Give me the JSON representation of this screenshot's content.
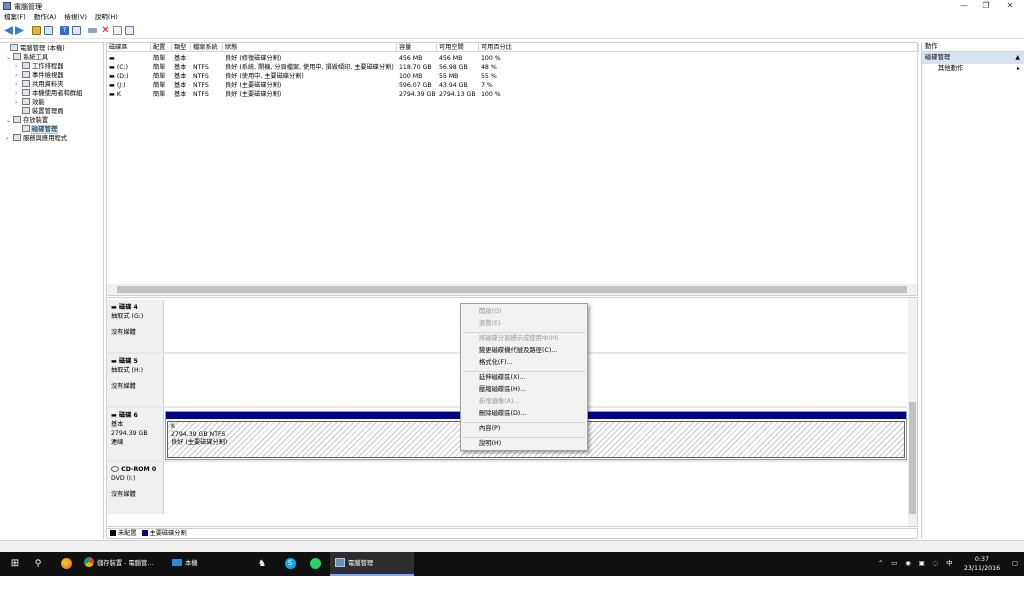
{
  "window": {
    "title": "電腦管理",
    "minimize_glyph": "—",
    "maximize_glyph": "❐",
    "close_glyph": "✕"
  },
  "menu": [
    "檔案(F)",
    "動作(A)",
    "檢視(V)",
    "說明(H)"
  ],
  "toolbar_icons": [
    "back-icon",
    "forward-icon",
    "up-folder-icon",
    "show-tree-icon",
    "help-icon",
    "show-pane-icon",
    "connect-icon",
    "delete-icon",
    "check-icon",
    "properties-icon"
  ],
  "tree": [
    {
      "label": "電腦管理 (本機)",
      "expander": ""
    },
    {
      "label": "系統工具",
      "expander": "⌄"
    },
    {
      "label": "工作排程器",
      "expander": "›"
    },
    {
      "label": "事件檢視器",
      "expander": "›"
    },
    {
      "label": "共用資料夾",
      "expander": "›"
    },
    {
      "label": "本機使用者和群組",
      "expander": "›"
    },
    {
      "label": "效能",
      "expander": "›"
    },
    {
      "label": "裝置管理員",
      "expander": ""
    },
    {
      "label": "存放裝置",
      "expander": "⌄"
    },
    {
      "label": "磁碟管理",
      "expander": ""
    },
    {
      "label": "服務與應用程式",
      "expander": "›"
    }
  ],
  "volume_table": {
    "headers": [
      "磁碟區",
      "配置",
      "類型",
      "檔案系統",
      "狀態",
      "容量",
      "可用空間",
      "可用百分比"
    ],
    "rows": [
      [
        "▬",
        "簡單",
        "基本",
        "",
        "良好 (修復磁碟分割)",
        "456 MB",
        "456 MB",
        "100 %"
      ],
      [
        "▬ (C:)",
        "簡單",
        "基本",
        "NTFS",
        "良好 (系統, 開機, 分頁檔案, 使用中, 損毀傾印, 主要磁碟分割)",
        "118.70 GB",
        "56.98 GB",
        "48 %"
      ],
      [
        "▬ (D:)",
        "簡單",
        "基本",
        "NTFS",
        "良好 (使用中, 主要磁碟分割)",
        "100 MB",
        "55 MB",
        "55 %"
      ],
      [
        "▬ (J:)",
        "簡單",
        "基本",
        "NTFS",
        "良好 (主要磁碟分割)",
        "596.07 GB",
        "43.94 GB",
        "7 %"
      ],
      [
        "▬ K",
        "簡單",
        "基本",
        "NTFS",
        "良好 (主要磁碟分割)",
        "2794.39 GB",
        "2794.13 GB",
        "100 %"
      ]
    ]
  },
  "disks": [
    {
      "name": "▬ 磁碟 4",
      "type": "抽取式 (G:)",
      "size": "",
      "status": "沒有媒體",
      "partition": null
    },
    {
      "name": "▬ 磁碟 5",
      "type": "抽取式 (H:)",
      "size": "",
      "status": "沒有媒體",
      "partition": null
    },
    {
      "name": "▬ 磁碟 6",
      "type": "基本",
      "size": "2794.39 GB",
      "status": "連線",
      "partition": {
        "label": "K",
        "size": "2794.39 GB NTFS",
        "status": "良好 (主要磁碟分割)"
      }
    },
    {
      "name": "CD-ROM 0",
      "type": "DVD (I:)",
      "size": "",
      "status": "沒有媒體",
      "partition": null
    }
  ],
  "legend": [
    {
      "label": "未配置",
      "color": "#000000"
    },
    {
      "label": "主要磁碟分割",
      "color": "#000080"
    }
  ],
  "context_menu": [
    {
      "label": "開啟(O)",
      "disabled": true
    },
    {
      "label": "瀏覽(E)",
      "disabled": true
    },
    {
      "sep": true
    },
    {
      "label": "將磁碟分割標示成使用中(M)",
      "disabled": true
    },
    {
      "label": "變更磁碟機代號及路徑(C)...",
      "disabled": false
    },
    {
      "label": "格式化(F)...",
      "disabled": false
    },
    {
      "sep": true
    },
    {
      "label": "延伸磁碟區(X)...",
      "disabled": false
    },
    {
      "label": "壓縮磁碟區(H)...",
      "disabled": false
    },
    {
      "label": "新增鏡像(A)...",
      "disabled": true
    },
    {
      "label": "刪除磁碟區(D)...",
      "disabled": false
    },
    {
      "sep": true
    },
    {
      "label": "內容(P)",
      "disabled": false
    },
    {
      "sep": true
    },
    {
      "label": "說明(H)",
      "disabled": false
    }
  ],
  "actions": {
    "header": "動作",
    "group": "磁碟管理",
    "item": "其他動作"
  },
  "taskbar": {
    "apps": [
      {
        "label": "儲存裝置 - 電腦管...",
        "icon": "chrome-icon"
      },
      {
        "label": "本機",
        "icon": "file-explorer-icon"
      },
      {
        "label": "電腦管理",
        "icon": "computer-management-icon"
      }
    ],
    "pinned_icons": [
      "firefox-icon",
      "shield-icon",
      "skype-icon",
      "whatsapp-icon"
    ],
    "time": "0:37",
    "date": "23/11/2016",
    "tray_glyphs": "⌃ ▭ ◉ ▣ ◌ 中 ▤"
  },
  "colors": {
    "primary_partition": "#000080",
    "selection": "#cde8ff",
    "actions_group": "#d6e4f2"
  }
}
